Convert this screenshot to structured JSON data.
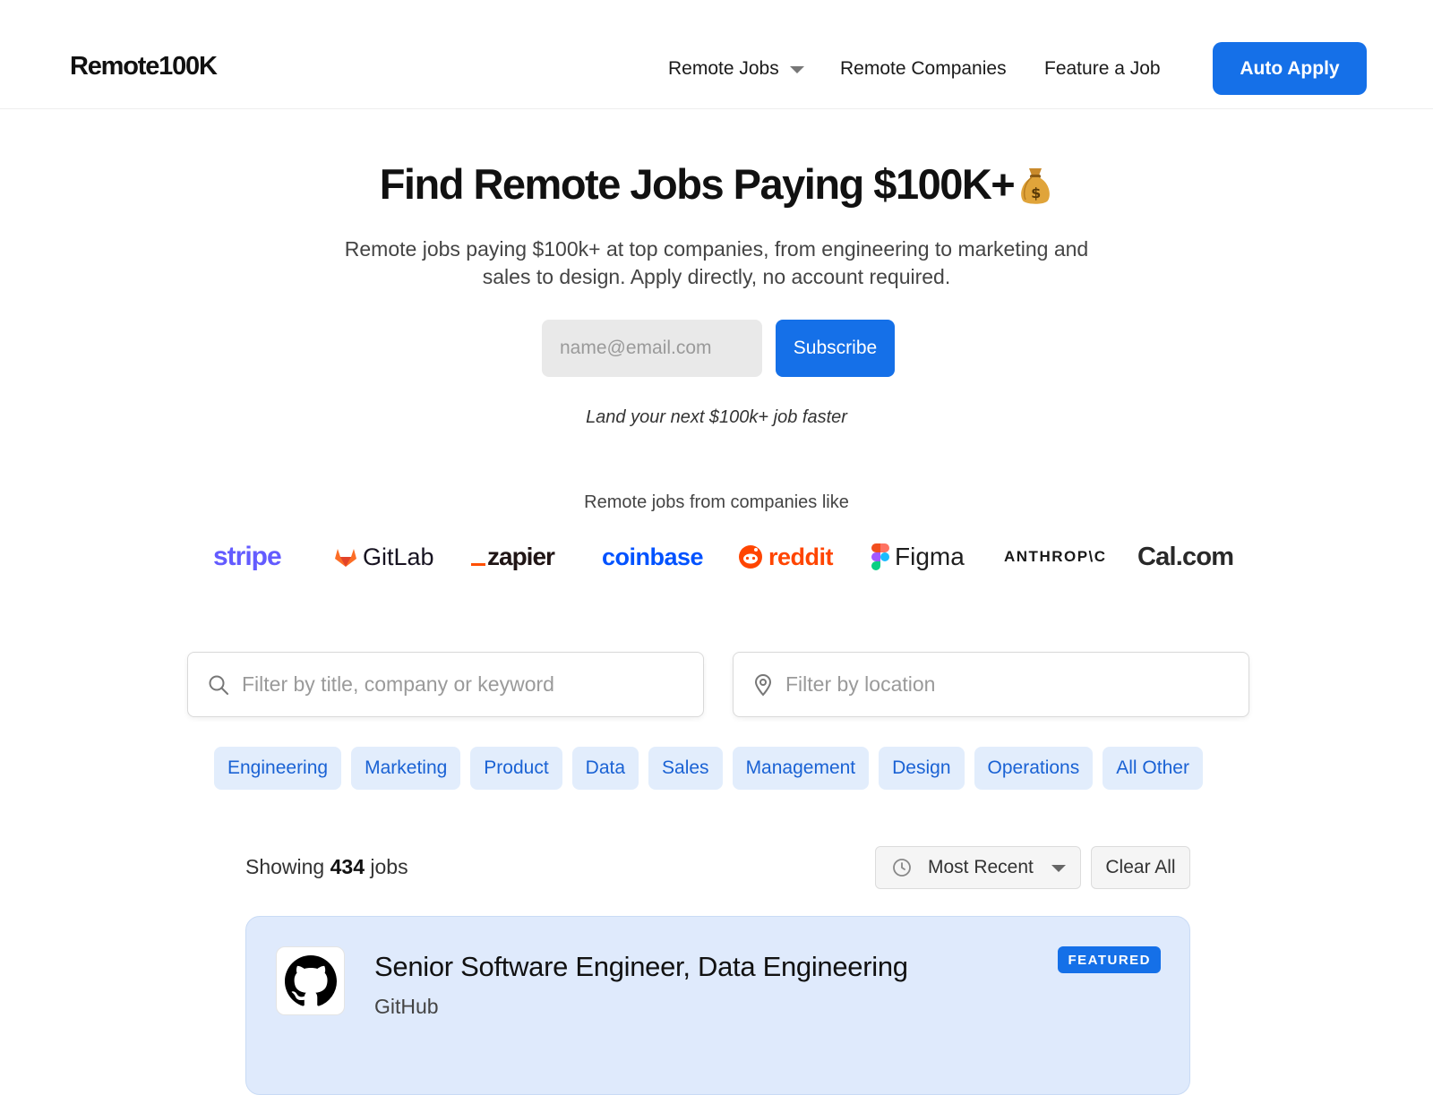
{
  "header": {
    "logo": "Remote100K",
    "nav": {
      "remote_jobs": "Remote Jobs",
      "remote_companies": "Remote Companies",
      "feature_job": "Feature a Job"
    },
    "cta": "Auto Apply"
  },
  "hero": {
    "title": "Find Remote Jobs Paying $100K+",
    "title_icon": "money-bag-icon",
    "subtitle": "Remote jobs paying $100k+ at top companies, from engineering to marketing and sales to design. Apply directly, no account required.",
    "email_placeholder": "name@email.com",
    "subscribe": "Subscribe",
    "tagline": "Land your next $100k+ job faster",
    "companies_label": "Remote jobs from companies like"
  },
  "company_logos": {
    "stripe": "stripe",
    "gitlab": "GitLab",
    "zapier": "zapier",
    "coinbase": "coinbase",
    "reddit": "reddit",
    "figma": "Figma",
    "anthropic": "ANTHROP\\C",
    "cal": "Cal.com"
  },
  "filters": {
    "title_placeholder": "Filter by title, company or keyword",
    "location_placeholder": "Filter by location",
    "categories": [
      "Engineering",
      "Marketing",
      "Product",
      "Data",
      "Sales",
      "Management",
      "Design",
      "Operations",
      "All Other"
    ]
  },
  "results": {
    "showing_prefix": "Showing",
    "count": "434",
    "showing_suffix": "jobs",
    "sort": "Most Recent",
    "clear": "Clear All"
  },
  "jobs": [
    {
      "title": "Senior Software Engineer, Data Engineering",
      "company": "GitHub",
      "badge": "FEATURED",
      "logo_icon": "github-icon"
    }
  ],
  "colors": {
    "accent": "#1570e8",
    "chip_bg": "#e2edfc",
    "chip_text": "#1a62d4",
    "featured_card_bg": "#dfeafc"
  }
}
